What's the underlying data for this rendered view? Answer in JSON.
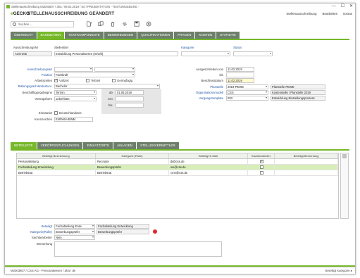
{
  "window": {
    "title": "Stellenausschreibung M2003807 / aha / 09.02.2019 / S0 / PRESENTATION - TESTUMGEBUNG -",
    "minimize": "—",
    "maximize": "☐",
    "close": "✕"
  },
  "header": {
    "logo_e": "e",
    "logo_rest": "GECKO",
    "record_title": "STELLENAUSSCHREIBUNG GEÄNDERT",
    "menu": [
      "Stellenausschreibung",
      "Bearbeiten",
      "Extras"
    ]
  },
  "toolbar": {
    "search_placeholder": "Suchen ...",
    "icons": [
      "new-document-icon",
      "copy-icon",
      "delete-icon",
      "settings-icon",
      "save-icon",
      "cancel-icon"
    ]
  },
  "tabs": [
    "ÜBERSICHT",
    "BASISDATEN",
    "TEXTKOMPONENTE",
    "BEWERBUNGEN",
    "QUALIFIKATIONEN",
    "FRAGEN",
    "KOSTEN",
    "STATISTIK"
  ],
  "active_tab": "BASISDATEN",
  "form": {
    "ausschreibungsnr_label": "AusschreibungsNr",
    "ausschreibungsnr": "AUS-205",
    "stellentitel_label": "Stellentitel",
    "stellentitel": "Entwicklung Personalwesen (m/w/d)",
    "kategorie_label": "Kategorie",
    "status_label": "Status",
    "ausschreibungsart_label": "Ausschreibungsart",
    "position_label": "Position",
    "position": "Fachkraft",
    "arbeitszeiten_label": "Arbeitszeiten",
    "vollzeit": "Vollzeit",
    "teilzeit": "Teilzeit",
    "geringfuegig": "Geringfügig",
    "bildungsgrad_label": "Bildungsgrad Mindestvor.",
    "bildungsgrad": "Bachelor",
    "beschaeftigungsbeginn_label": "Beschäftigungsbeginn",
    "beschaeftigungsbeginn": "Termin",
    "ab_label": "ab",
    "ab_date": "01.05.2019",
    "vertragsform_label": "Vertragsform",
    "vertragsform": "unbefristet",
    "von_label": "von",
    "bis_label": "bis",
    "einsatzort_label": "Einsatzort",
    "deutschlandweit": "Deutschlandweit",
    "kennzeichen_label": "Kennzeichen",
    "kennzeichen": "EntPeEe-BWM",
    "ausgeschrieben_von_label": "Ausgeschrieben von",
    "ausgeschrieben_von": "11.02.2019",
    "ausgeschrieben_bis_label": "bis",
    "beschlussdatum_label": "Beschlussdatum",
    "beschlussdatum": "11.02.2019",
    "planstelle_label": "Planstelle",
    "planstelle_code": "2019-PEWE",
    "planstelle_name": "Planstelle PEWE",
    "organisationsmodell_label": "Organisationsmodell",
    "organisationsmodell_code": "CSS",
    "organisationsmodell_name": "Kostenstelle / Planstelle 2019",
    "vorgangstemplate_label": "Vorgangstemplate",
    "vorgangstemplate_code": "003",
    "vorgangstemplate_name": "Entwicklung Einstellungsprozess"
  },
  "subtabs": [
    "BETEILIGTE",
    "VERÖFFENTLICHUNGEN",
    "EINSATZORTE",
    "ANLAGEN",
    "STELLENVERMITTLER"
  ],
  "grid": {
    "columns": [
      "Beteiligt Bezeichnung",
      "Kategorie (Rolle)",
      "Beteiligt E-Mail",
      "Sachbearbeiter",
      "Beteiligt Bemerkung"
    ],
    "rows": [
      {
        "bezeichnung": "Personalleitung",
        "kategorie": "Recruiter",
        "email": "jb@css.de",
        "sachbearbeiter": true,
        "bemerkung": ""
      },
      {
        "bezeichnung": "Fachabteilung Entwicklung",
        "kategorie": "Bewerbungsprüfer",
        "email": "wo@css.de",
        "sachbearbeiter": false,
        "bemerkung": ""
      },
      {
        "bezeichnung": "Betriebsrat",
        "kategorie": "Betriebsrat",
        "email": "cme@css.de",
        "sachbearbeiter": false,
        "bemerkung": ""
      }
    ]
  },
  "detail": {
    "beteiligt_label": "Beteiligt",
    "beteiligt_code": "Fachabteilung Entw",
    "beteiligt_name": "Fachabteilung Entwicklung",
    "kategorie_label": "Kategorie(Rolle)",
    "kategorie_code": "Bewerbungsprüfer",
    "kategorie_name": "Bewerbungsprüfer",
    "sachbearbeiter_label": "Sachbearbeiter",
    "sachbearbeiter": "Nein",
    "bemerkung_label": "Bemerkung"
  },
  "status_bar": {
    "left": "M2003807 / CSS AG - Personalwesen / aha / de",
    "right": "Beteiligt Kategorie ▸"
  },
  "colors": {
    "accent": "#76b82a",
    "tab_inactive": "#6d7f6a",
    "link_blue": "#2458a8",
    "required_red": "#e0282e"
  }
}
